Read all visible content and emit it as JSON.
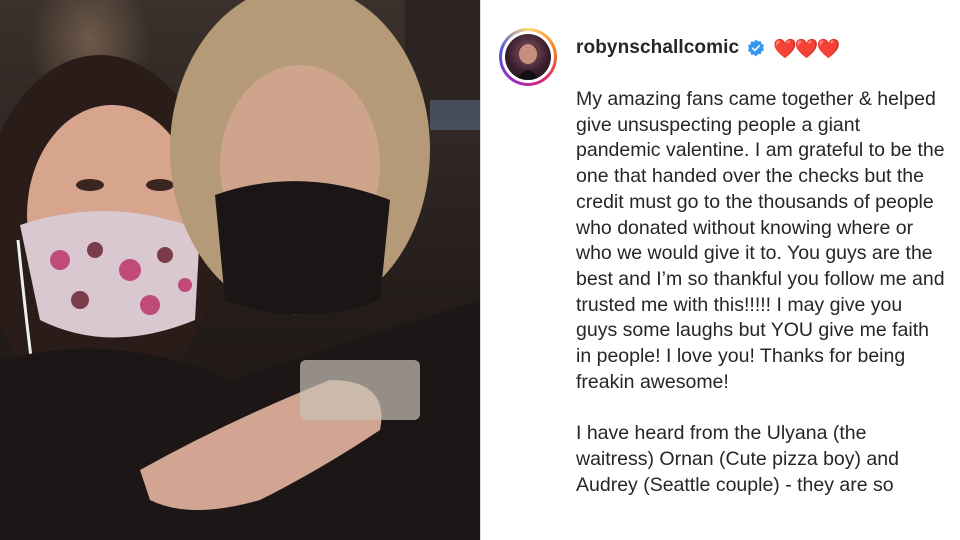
{
  "post": {
    "username": "robynschallcomic",
    "verified_icon": "verified-badge-icon",
    "hearts": "❤️❤️❤️",
    "caption_paragraphs": [
      "My amazing fans came together & helped give unsuspecting people a giant pandemic valentine. I am grateful to be the one that handed over the checks but the credit must go to the thousands of people who donated without knowing where or who we would give it to. You guys are the best and I’m so thankful you follow me and trusted me with this!!!!! I may give you guys some laughs but YOU give me faith in people! I love you! Thanks for being freakin awesome!",
      "I have heard from the Ulyana (the waitress) Ornan (Cute pizza boy) and Audrey (Seattle couple) - they are so"
    ]
  },
  "colors": {
    "text": "#262626",
    "verified": "#3897f0",
    "divider": "#dbdbdb"
  }
}
